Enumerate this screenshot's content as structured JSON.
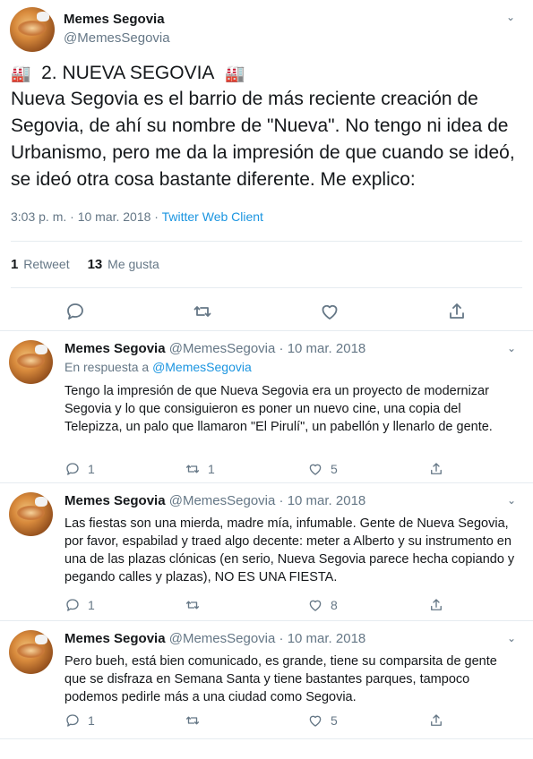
{
  "main_tweet": {
    "author_name": "Memes Segovia",
    "author_handle": "@MemesSegovia",
    "headline": "2. NUEVA SEGOVIA",
    "headline_emoji": "factory-icon",
    "body": "Nueva Segovia es el barrio de más reciente creación de Segovia, de ahí su nombre de \"Nueva\". No tengo ni idea de Urbanismo, pero me da la impresión de que cuando se ideó, se ideó otra cosa bastante diferente. Me explico:",
    "timestamp": "3:03 p. m. · 10 mar. 2018 · ",
    "client": "Twitter Web Client",
    "retweets_count": "1",
    "retweets_label": "Retweet",
    "likes_count": "13",
    "likes_label": "Me gusta"
  },
  "replies": [
    {
      "name": "Memes Segovia",
      "handle": "@MemesSegovia",
      "date": "10 mar. 2018",
      "in_reply_prefix": "En respuesta a ",
      "in_reply_mention": "@MemesSegovia",
      "text": "Tengo la impresión de que Nueva Segovia era un proyecto de modernizar Segovia y lo que consiguieron es poner un nuevo cine, una copia del Telepizza, un palo que llamaron \"El Pirulí\", un pabellón y llenarlo de gente.",
      "reply_count": "1",
      "retweet_count": "1",
      "like_count": "5"
    },
    {
      "name": "Memes Segovia",
      "handle": "@MemesSegovia",
      "date": "10 mar. 2018",
      "text": "Las fiestas son una mierda, madre mía, infumable. Gente de Nueva Segovia, por favor, espabilad y traed algo decente: meter a Alberto y su instrumento en una de las plazas clónicas (en serio, Nueva Segovia parece hecha copiando y pegando calles y plazas), NO ES UNA FIESTA.",
      "reply_count": "1",
      "retweet_count": "",
      "like_count": "8"
    },
    {
      "name": "Memes Segovia",
      "handle": "@MemesSegovia",
      "date": "10 mar. 2018",
      "text": "Pero bueh, está bien comunicado, es grande, tiene su comparsita de gente que se disfraza en Semana Santa  y tiene bastantes parques, tampoco podemos pedirle más a una ciudad como Segovia.",
      "reply_count": "1",
      "retweet_count": "",
      "like_count": "5"
    }
  ],
  "colors": {
    "text": "#14171a",
    "secondary": "#657786",
    "link": "#1b95e0",
    "divider": "#e6ecf0"
  }
}
